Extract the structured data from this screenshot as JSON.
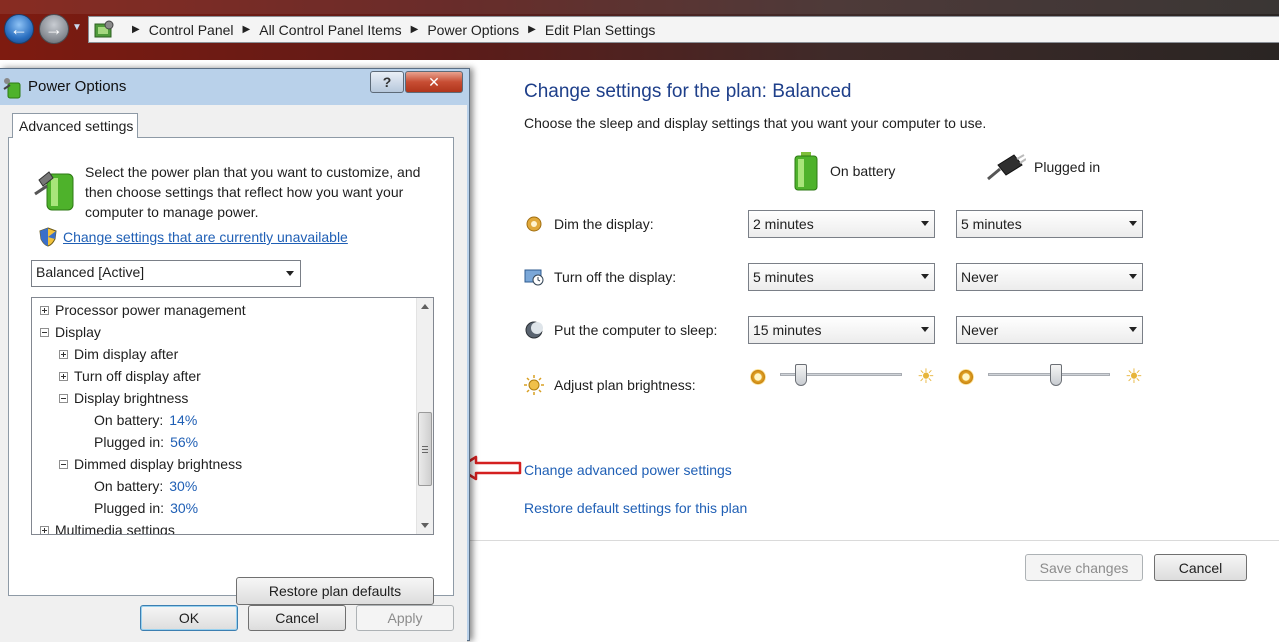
{
  "address_bar": {
    "breadcrumbs": [
      "Control Panel",
      "All Control Panel Items",
      "Power Options",
      "Edit Plan Settings"
    ]
  },
  "main": {
    "title": "Change settings for the plan: Balanced",
    "subtitle": "Choose the sleep and display settings that you want your computer to use.",
    "columns": {
      "battery": "On battery",
      "plugged": "Plugged in"
    },
    "rows": [
      {
        "label": "Dim the display:",
        "battery": "2 minutes",
        "plugged": "5 minutes",
        "icon": "dim-display-icon"
      },
      {
        "label": "Turn off the display:",
        "battery": "5 minutes",
        "plugged": "Never",
        "icon": "display-off-icon"
      },
      {
        "label": "Put the computer to sleep:",
        "battery": "15 minutes",
        "plugged": "Never",
        "icon": "sleep-moon-icon"
      },
      {
        "label": "Adjust plan brightness:",
        "battery_level": 0.14,
        "plugged_level": 0.56,
        "icon": "brightness-icon"
      }
    ],
    "links": {
      "advanced": "Change advanced power settings",
      "restore": "Restore default settings for this plan"
    },
    "buttons": {
      "save": "Save changes",
      "cancel": "Cancel"
    }
  },
  "dialog": {
    "title": "Power Options",
    "tab": "Advanced settings",
    "intro": "Select the power plan that you want to customize, and then choose settings that reflect how you want your computer to manage power.",
    "change_link": "Change settings that are currently unavailable",
    "plan": "Balanced [Active]",
    "tree": [
      {
        "label": "Processor power management",
        "level": 0,
        "expander": "plus"
      },
      {
        "label": "Display",
        "level": 0,
        "expander": "minus"
      },
      {
        "label": "Dim display after",
        "level": 1,
        "expander": "plus"
      },
      {
        "label": "Turn off display after",
        "level": 1,
        "expander": "plus"
      },
      {
        "label": "Display brightness",
        "level": 1,
        "expander": "minus"
      },
      {
        "label": "On battery:",
        "level": 2,
        "value": "14%"
      },
      {
        "label": "Plugged in:",
        "level": 2,
        "value": "56%"
      },
      {
        "label": "Dimmed display brightness",
        "level": 1,
        "expander": "minus"
      },
      {
        "label": "On battery:",
        "level": 2,
        "value": "30%"
      },
      {
        "label": "Plugged in:",
        "level": 2,
        "value": "30%"
      },
      {
        "label": "Multimedia settings",
        "level": 0,
        "expander": "plus"
      }
    ],
    "buttons": {
      "restore_defaults": "Restore plan defaults",
      "ok": "OK",
      "cancel": "Cancel",
      "apply": "Apply"
    },
    "help_glyph": "?",
    "close_glyph": "✕"
  },
  "colors": {
    "link": "#1f5fb5",
    "title_blue": "#1e3f8a",
    "annotation_arrow": "#d42020"
  }
}
